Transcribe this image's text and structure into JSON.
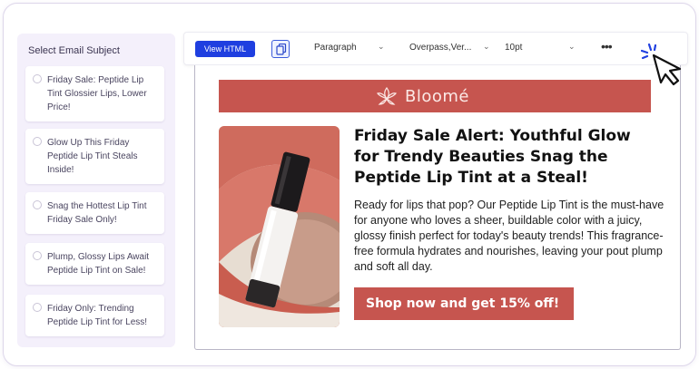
{
  "sidebar": {
    "title": "Select Email Subject",
    "subjects": [
      "Friday Sale: Peptide Lip Tint Glossier Lips, Lower Price!",
      "Glow Up This Friday Peptide Lip Tint Steals Inside!",
      "Snag the Hottest Lip Tint Friday Sale Only!",
      "Plump, Glossy Lips Await Peptide Lip Tint on Sale!",
      "Friday Only: Trending Peptide Lip Tint for Less!"
    ]
  },
  "toolbar": {
    "view_html_label": "View HTML",
    "copy_icon": "copy-icon",
    "block_format": "Paragraph",
    "font_family": "Overpass,Ver...",
    "font_size": "10pt",
    "more_icon": "more-horizontal-icon"
  },
  "email": {
    "brand_name": "Bloomé",
    "brand_color": "#c6554f",
    "headline": "Friday Sale Alert: Youthful Glow for Trendy Beauties Snag the Peptide Lip Tint at a Steal!",
    "body": "Ready for lips that pop? Our Peptide Lip Tint is the must-have for anyone who loves a sheer, buildable color with a juicy, glossy finish perfect for today's beauty trends! This fragrance-free formula hydrates and nourishes, leaving your pout plump and soft all day.",
    "cta_label": "Shop now and get 15% off!"
  },
  "colors": {
    "accent": "#1f3fe0",
    "sidebar_bg": "#f4f0fb"
  }
}
